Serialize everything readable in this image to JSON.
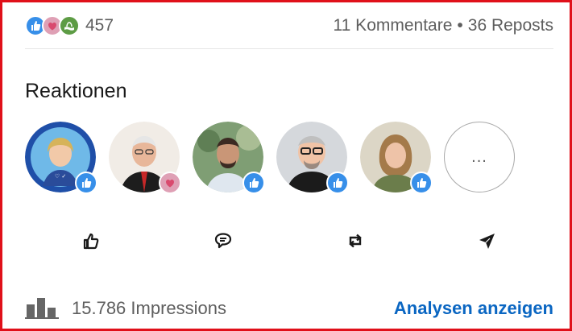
{
  "social_counts": {
    "reaction_icons": [
      "like-icon",
      "love-icon",
      "support-icon"
    ],
    "total_reactions": "457",
    "comments": "11 Kommentare",
    "separator": "•",
    "reposts": "36 Reposts"
  },
  "reactions_section": {
    "title": "Reaktionen",
    "reactors": [
      {
        "reaction": "like-icon"
      },
      {
        "reaction": "love-icon"
      },
      {
        "reaction": "like-icon"
      },
      {
        "reaction": "like-icon"
      },
      {
        "reaction": "like-icon"
      }
    ],
    "more_label": "..."
  },
  "actions": [
    {
      "icon": "like-icon"
    },
    {
      "icon": "comment-icon"
    },
    {
      "icon": "repost-icon"
    },
    {
      "icon": "send-icon"
    }
  ],
  "impressions": {
    "icon": "bar-chart-icon",
    "text": "15.786 Impressions",
    "analytics_link": "Analysen anzeigen"
  },
  "colors": {
    "frame_border": "#e0101a",
    "link": "#0a66c2",
    "like_badge": "#378fe9",
    "love_badge": "#dfa0b5",
    "support_badge": "#5d9c45",
    "muted_text": "#5e5e5e"
  }
}
